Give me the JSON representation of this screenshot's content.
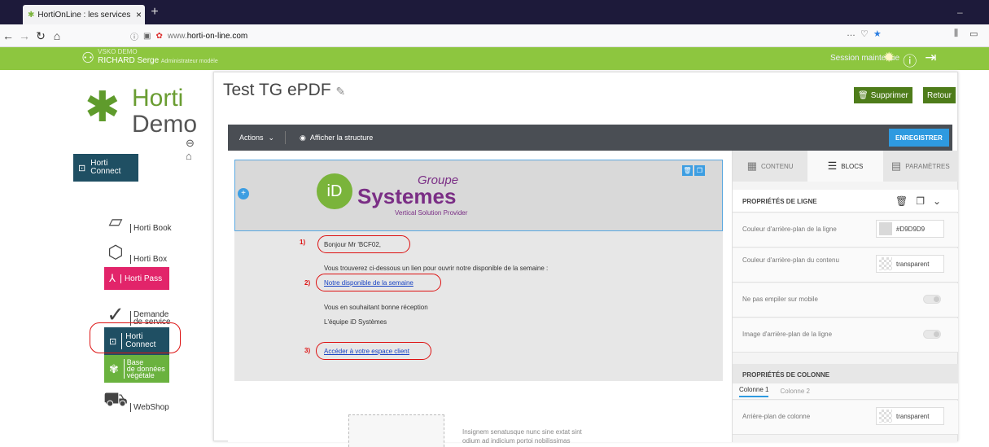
{
  "browser": {
    "tab_title": "HortiOnLine : les services en lig",
    "url_prefix": "www.",
    "url_domain": "horti-on-line.com",
    "more_icon": "…",
    "new_tab": "+",
    "min": "–"
  },
  "topbar": {
    "user_line1": "VSKO DEMO",
    "user_name": "RICHARD Serge",
    "user_role": "Administrateur modèle",
    "session": "Session maintenue"
  },
  "sidebar": {
    "logo_top": "Horti",
    "logo_bottom": "Demo",
    "hc_top": "Horti",
    "hc_bottom": "Connect",
    "items": [
      {
        "label": "Horti Book"
      },
      {
        "label": "Horti Box"
      },
      {
        "label": "Horti Pass"
      },
      {
        "label_1": "Demande",
        "label_2": "de service"
      },
      {
        "label_1": "Horti",
        "label_2": "Connect"
      },
      {
        "label_1": "Base",
        "label_2": "de données",
        "label_3": "végétale"
      },
      {
        "label": "WebShop"
      }
    ]
  },
  "page": {
    "title": "Test TG ePDF",
    "delete_label": "Supprimer",
    "back_label": "Retour"
  },
  "toolbar": {
    "actions_label": "Actions",
    "structure_label": "Afficher la structure",
    "save_label": "ENREGISTRER"
  },
  "email": {
    "groupe": "Groupe",
    "id": "iD",
    "systemes": "Systemes",
    "tagline": "Vertical Solution Provider",
    "greeting": "Bonjour Mr 'BCF02,",
    "intro": "Vous trouverez ci-dessous un lien pour ouvrir notre disponible de la semaine :",
    "link1": "Notre disponible de la semaine",
    "closing": "Vous en souhaitant bonne réception",
    "sign_prefix": "L'équipe ",
    "sign_id": "iD",
    "sign_suffix": " Systèmes",
    "link2": "Accéder à votre espace client",
    "marker1": "1)",
    "marker2": "2)",
    "marker3": "3)",
    "lorem1": "Insignem senatusque nunc sine extat sint",
    "lorem2": "odium ad indicium portoi nobilissimas"
  },
  "panel": {
    "tabs": [
      "CONTENU",
      "BLOCS",
      "PARAMÈTRES"
    ],
    "line_props": "PROPRIÉTÉS DE LIGNE",
    "row_bg_label": "Couleur d'arrière-plan de la ligne",
    "row_bg_value": "#D9D9D9",
    "content_bg_label": "Couleur d'arrière-plan du contenu",
    "content_bg_value": "transparent",
    "stack_label": "Ne pas empiler sur mobile",
    "bgimage_label": "Image d'arrière-plan de la ligne",
    "col_props": "PROPRIÉTÉS DE COLONNE",
    "col_tabs": [
      "Colonne 1",
      "Colonne 2"
    ],
    "col_bg_label": "Arrière-plan de colonne",
    "col_bg_value": "transparent"
  },
  "colors": {
    "green_bar": "#8dc63f",
    "dark_toolbar": "#4a4e54",
    "save_blue": "#2e9ae0",
    "brand_purple": "#7a2e85",
    "annotation_red": "#dd1111"
  }
}
